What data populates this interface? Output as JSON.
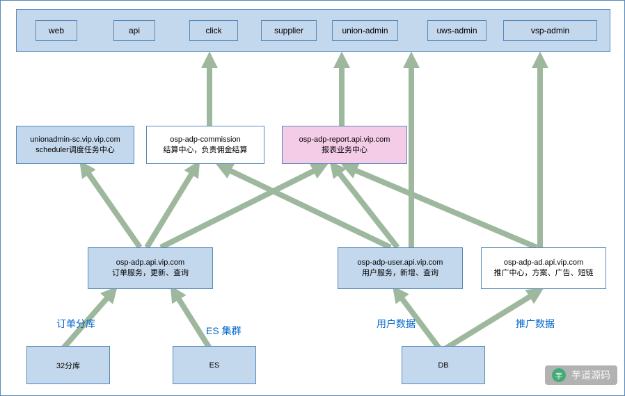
{
  "top_bar": {
    "items": [
      "web",
      "api",
      "click",
      "supplier",
      "union-admin",
      "uws-admin",
      "vsp-admin"
    ]
  },
  "mid_layer": {
    "scheduler": {
      "line1": "unionadmin-sc.vip.vip.com",
      "line2": "scheduler调度任务中心"
    },
    "commission": {
      "line1": "osp-adp-commission",
      "line2": "结算中心，负责佣金结算"
    },
    "report": {
      "line1": "osp-adp-report.api.vip.com",
      "line2": "报表业务中心"
    }
  },
  "service_layer": {
    "order": {
      "line1": "osp-adp.api.vip.com",
      "line2": "订单服务，更新、查询"
    },
    "user": {
      "line1": "osp-adp-user.api.vip.com",
      "line2": "用户服务，新增、查询"
    },
    "ad": {
      "line1": "osp-adp-ad.api.vip.com",
      "line2": "推广中心，方案、广告、短链"
    }
  },
  "db_layer": {
    "shard": "32分库",
    "es": "ES",
    "db": "DB"
  },
  "labels": {
    "shard_label": "订单分库",
    "es_label": "ES 集群",
    "user_data": "用户数据",
    "promo_data": "推广数据"
  },
  "watermark": "芋道源码"
}
